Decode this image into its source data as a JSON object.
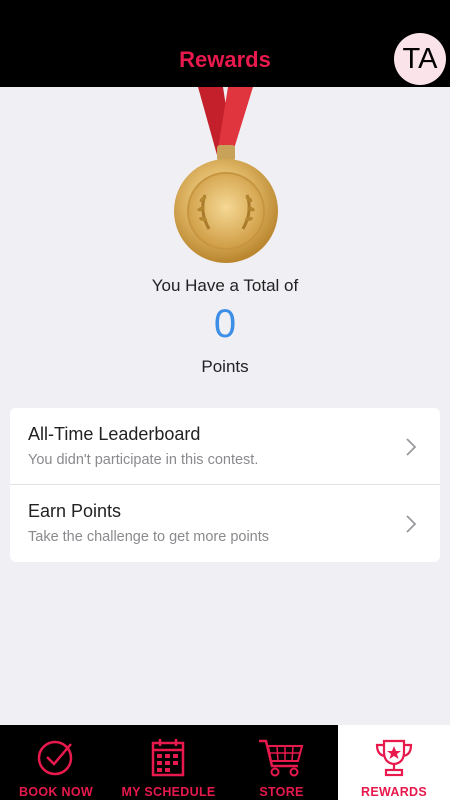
{
  "header": {
    "title": "Rewards",
    "avatar_initials": "TA"
  },
  "summary": {
    "total_label": "You Have a Total of",
    "points_value": "0",
    "points_unit": "Points"
  },
  "list": {
    "items": [
      {
        "title": "All-Time Leaderboard",
        "subtitle": "You didn't participate in this contest."
      },
      {
        "title": "Earn Points",
        "subtitle": "Take the challenge to get more points"
      }
    ]
  },
  "tabbar": {
    "tabs": [
      {
        "label": "BOOK NOW",
        "icon": "check-circle-icon"
      },
      {
        "label": "MY SCHEDULE",
        "icon": "calendar-icon"
      },
      {
        "label": "STORE",
        "icon": "cart-icon"
      },
      {
        "label": "REWARDS",
        "icon": "trophy-icon",
        "active": true
      }
    ]
  },
  "colors": {
    "accent": "#e8194d",
    "points": "#3d8ee6",
    "header_bg": "#000000"
  }
}
